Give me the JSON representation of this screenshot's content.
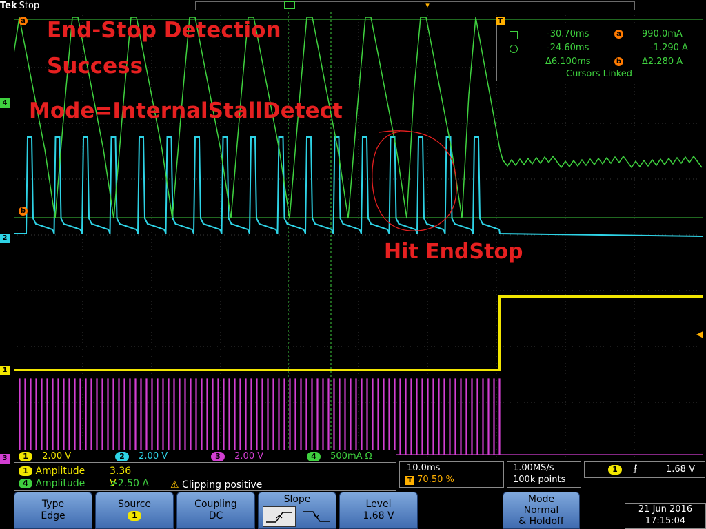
{
  "top": {
    "brand": "Tek",
    "status": "Stop"
  },
  "annotations": {
    "title_line1": "End-Stop Detection",
    "title_line2": "Success",
    "mode": "Mode=InternalStallDetect",
    "hit": "Hit EndStop"
  },
  "markers": {
    "ch4": "4",
    "ch2": "2",
    "ch1": "1",
    "ch3": "3",
    "cursor_a": "a",
    "cursor_b": "b",
    "trigger": "T"
  },
  "cursors": {
    "t1": "-30.70ms",
    "a_value": "990.0mA",
    "t2": "-24.60ms",
    "b_value": "-1.290 A",
    "dt": "Δ6.100ms",
    "dv": "Δ2.280 A",
    "linked": "Cursors Linked"
  },
  "channels": [
    {
      "num": "1",
      "scale": "2.00 V",
      "color": "#f2e600"
    },
    {
      "num": "2",
      "scale": "2.00 V",
      "color": "#2ed3e6"
    },
    {
      "num": "3",
      "scale": "2.00 V",
      "color": "#d23fd2"
    },
    {
      "num": "4",
      "scale": "500mA Ω",
      "color": "#3fd13f"
    }
  ],
  "measurements": {
    "m1_label": "Amplitude",
    "m1_value": "3.36 V",
    "m2_label": "Amplitude",
    "m2_value": ">2.50 A",
    "warning": "Clipping positive"
  },
  "horizontal": {
    "scale": "10.0ms",
    "position": "70.50 %"
  },
  "acquisition": {
    "rate": "1.00MS/s",
    "points": "100k points"
  },
  "trigger": {
    "source": "1",
    "level": "1.68 V"
  },
  "menu": {
    "type_label": "Type",
    "type_value": "Edge",
    "source_label": "Source",
    "source_value": "1",
    "coupling_label": "Coupling",
    "coupling_value": "DC",
    "slope_label": "Slope",
    "level_label": "Level",
    "level_value": "1.68 V",
    "mode_label": "Mode",
    "mode_value1": "Normal",
    "mode_value2": "& Holdoff"
  },
  "datetime": {
    "date": "21 Jun 2016",
    "time": "17:15:04"
  },
  "colors": {
    "ch1": "#f2e600",
    "ch2": "#2ed3e6",
    "ch3": "#d23fd2",
    "ch4": "#3fd13f",
    "annotation": "#e62020",
    "cursor": "#ff7a00"
  }
}
